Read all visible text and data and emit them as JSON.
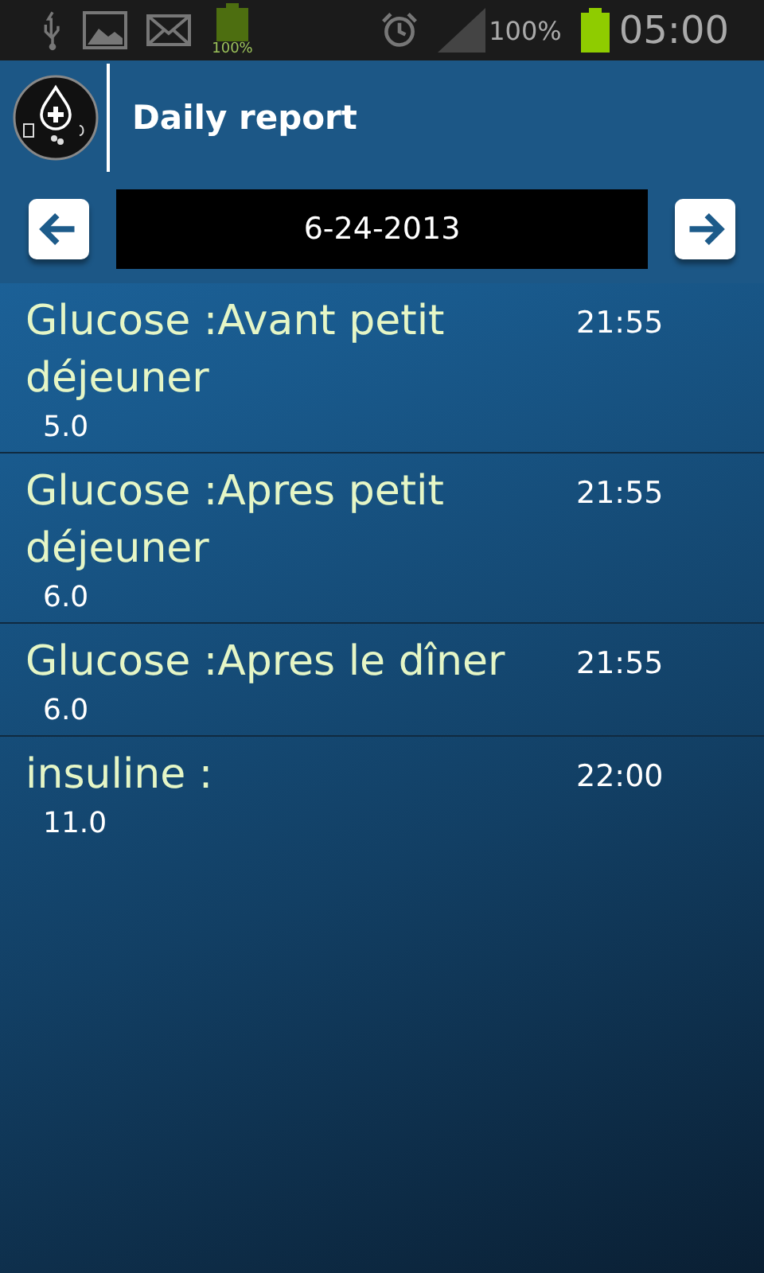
{
  "status_bar": {
    "battery_small_label": "100%",
    "battery_percent": "100%",
    "time": "05:00"
  },
  "header": {
    "title": "Daily report"
  },
  "date_nav": {
    "date": "6-24-2013"
  },
  "entries": [
    {
      "title": "Glucose :Avant petit déjeuner",
      "time": "21:55",
      "value": "5.0"
    },
    {
      "title": "Glucose :Apres petit déjeuner",
      "time": "21:55",
      "value": "6.0"
    },
    {
      "title": "Glucose :Apres le dîner",
      "time": "21:55",
      "value": "6.0"
    },
    {
      "title": "insuline :",
      "time": "22:00",
      "value": "11.0"
    }
  ]
}
